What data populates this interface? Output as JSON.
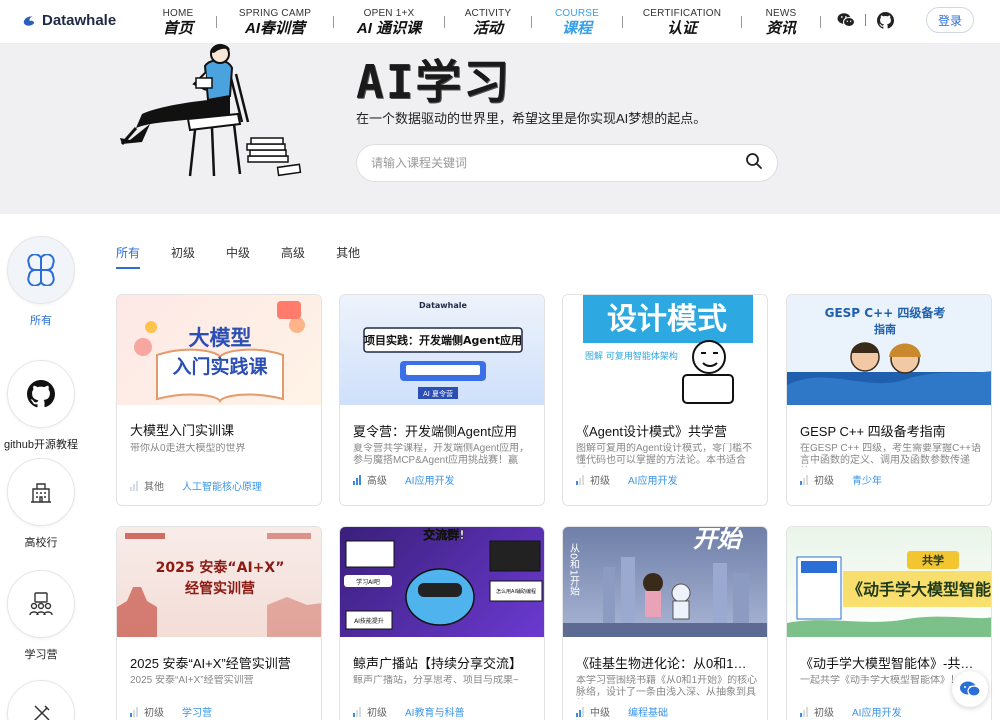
{
  "brand": {
    "name": "Datawhale"
  },
  "nav": [
    {
      "en": "HOME",
      "cn": "首页",
      "active": false
    },
    {
      "en": "SPRING CAMP",
      "cn": "AI春训营",
      "active": false
    },
    {
      "en": "OPEN 1+X",
      "cn": "AI 通识课",
      "active": false
    },
    {
      "en": "ACTIVITY",
      "cn": "活动",
      "active": false
    },
    {
      "en": "COURSE",
      "cn": "课程",
      "active": true
    },
    {
      "en": "CERTIFICATION",
      "cn": "认证",
      "active": false
    },
    {
      "en": "NEWS",
      "cn": "资讯",
      "active": false
    }
  ],
  "header": {
    "login_label": "登录",
    "icons": [
      "wechat-icon",
      "github-icon"
    ]
  },
  "hero": {
    "title": "AI学习",
    "subtitle": "在一个数据驱动的世界里，希望这里是你实现AI梦想的起点。",
    "search_placeholder": "请输入课程关键词"
  },
  "sidebar": [
    {
      "label": "所有",
      "icon": "grid-icon",
      "active": true
    },
    {
      "label": "github开源教程",
      "icon": "github-icon",
      "active": false
    },
    {
      "label": "高校行",
      "icon": "building-icon",
      "active": false
    },
    {
      "label": "学习营",
      "icon": "group-icon",
      "active": false
    },
    {
      "label": "",
      "icon": "tools-icon",
      "active": false
    }
  ],
  "tabs": [
    {
      "label": "所有",
      "active": true
    },
    {
      "label": "初级",
      "active": false
    },
    {
      "label": "中级",
      "active": false
    },
    {
      "label": "高级",
      "active": false
    },
    {
      "label": "其他",
      "active": false
    }
  ],
  "cards": [
    {
      "title": "大模型入门实训课",
      "desc": "带你从0走进大模型的世界",
      "level": "其他",
      "level_value": 0,
      "tag": "人工智能核心原理",
      "image_text": [
        "大模型",
        "入门实践课"
      ]
    },
    {
      "title": "夏令营：开发端侧Agent应用",
      "desc": "夏令营共学课程，开发端侧Agent应用，参与魔搭MCP&Agent应用挑战赛！赢AMD…",
      "level": "高级",
      "level_value": 3,
      "tag": "AI应用开发",
      "image_text": [
        "Datawhale",
        "项目实践：开发端侧Agent应用",
        "AI 夏令营"
      ]
    },
    {
      "title": "《Agent设计模式》共学营",
      "desc": "图解可复用的Agent设计模式，零门槛不懂代码也可以掌握的方法论。本书适合对…",
      "level": "初级",
      "level_value": 1,
      "tag": "AI应用开发",
      "image_text": [
        "设计模式",
        "图解 可复用智能体架构"
      ]
    },
    {
      "title": "GESP C++ 四级备考指南",
      "desc": "在GESP C++ 四级，考生需要掌握C++语言中函数的定义、调用及函数参数传递的…",
      "level": "初级",
      "level_value": 1,
      "tag": "青少年",
      "image_text": [
        "GESP C++ 四级备考",
        "指南"
      ]
    },
    {
      "title": "2025 安泰“AI+X”经管实训营",
      "desc": "2025 安泰“AI+X”经管实训营",
      "level": "初级",
      "level_value": 1,
      "tag": "学习营",
      "image_text": [
        "2025 安泰“AI+X”",
        "经管实训营"
      ]
    },
    {
      "title": "鲸声广播站【持续分享交流】",
      "desc": "鲸声广播站，分享思考、项目与成果~",
      "level": "初级",
      "level_value": 1,
      "tag": "AI教育与科普",
      "image_text": [
        "交流群!",
        "学习AI吧",
        "怎么用AI辅助编程",
        "AI技能提升"
      ]
    },
    {
      "title": "《硅基生物进化论：从0和1开…",
      "desc": "本学习营围绕书籍《从0和1开始》的核心脉络，设计了一条由浅入深、从抽象到具体…",
      "level": "中级",
      "level_value": 2,
      "tag": "编程基础",
      "image_text": [
        "从0和1开始",
        "开始"
      ]
    },
    {
      "title": "《动手学大模型智能体》-共…",
      "desc": "一起共学《动手学大模型智能体》！",
      "level": "初级",
      "level_value": 1,
      "tag": "AI应用开发",
      "image_text": [
        "共学",
        "《动手学大模型智能体"
      ]
    }
  ],
  "colors": {
    "accent": "#2b6fd6",
    "active_nav": "#3aa0e6",
    "tag": "#3a95e8"
  }
}
